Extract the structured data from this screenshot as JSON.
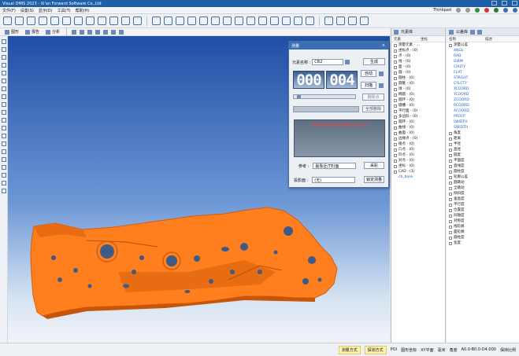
{
  "titlebar": {
    "title": "Visual DMIS 2023 - Xi'an Forward Software Co.,Ltd"
  },
  "menubar": {
    "items": [
      "文件(F)",
      "设置(S)",
      "显示(D)",
      "工具(T)",
      "帮助(H)"
    ],
    "profile": "Thinkpad"
  },
  "toolbar2": {
    "tabs": [
      "图形",
      "报告",
      "分析"
    ]
  },
  "dialog": {
    "title": "测量",
    "name_label": "元素名称 :",
    "name_value": "CB2",
    "generate_button": "生成",
    "auto_button": "自动",
    "scan_button": "扫描",
    "delete_point_button": "删除点",
    "delete_all_button": "全部删除",
    "digit_left": "000",
    "digit_right": "004",
    "message": "测量结束或达到测量点数量后点击[生成]",
    "reference_label": "参考 :",
    "reference_value": "最靠近(TE)面",
    "cancel_button": "采彩",
    "projection_label": "投影面 :",
    "projection_value": "(无)",
    "fixed_button": "锁定测量"
  },
  "elemPanel": {
    "tab": "元素库",
    "col1": "元素",
    "col2": "坐标",
    "items": [
      "测量元素 - ...",
      "坐标点 - (0)",
      "点 - (0)",
      "线 - (0)",
      "面 - (0)",
      "圆 - (0)",
      "圆柱 - (0)",
      "圆锥 - (0)",
      "球 - (0)",
      "椭圆 - (0)",
      "圆环 - (0)",
      "键槽 - (0)",
      "平行面 - (0)",
      "多边形 - (0)",
      "圆环 - (0)",
      "曲线 - (0)",
      "曲面 - (0)",
      "边缘点 - (0)",
      "棱点 - (0)",
      "凸点 - (0)",
      "凹点 - (0)",
      "对点 - (0)",
      "坐标 - (0)",
      "CAD - (1)"
    ],
    "sub_item": "cb_base"
  },
  "paramPanel": {
    "tab": "公差库",
    "col1": "名称",
    "col2": "描述",
    "root": "测量公差",
    "params": [
      "ANGL",
      "RAD",
      "DIAM",
      "CIRLTY",
      "FLAT",
      "STRGHT",
      "CYLCTY",
      "XCOORD",
      "YCOORD",
      "ZCOORD",
      "RCOORD",
      "ACOORD",
      "PROFP",
      "LWIDTH",
      "SWIDTH"
    ],
    "groups": [
      "角度",
      "距离",
      "半径",
      "直径",
      "圆度",
      "平面度",
      "直线度",
      "圆柱度",
      "轮廓公差",
      "圆跳动",
      "全跳动",
      "倾斜度",
      "垂直度",
      "平行度",
      "位置度",
      "同轴度",
      "对称度",
      "线轮廓",
      "面轮廓",
      "圆柱度",
      "宽度"
    ]
  },
  "statusbar": {
    "items": [
      "测量方式",
      "探测方式",
      "POI",
      "图形坐标",
      "XY平面",
      "毫米",
      "角度",
      "A0.0-B0.0-D4.000",
      "保持比例"
    ]
  },
  "colors": {
    "part": "#ff7f1f",
    "accent": "#1f5fa8"
  }
}
